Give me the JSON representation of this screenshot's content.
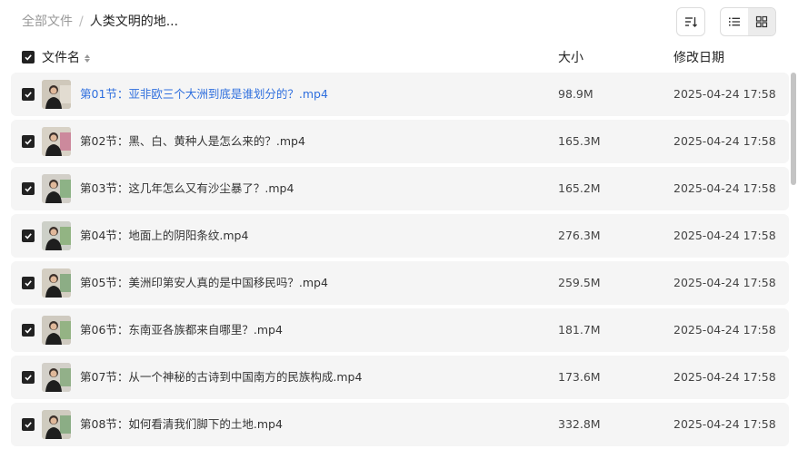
{
  "breadcrumb": {
    "root": "全部文件",
    "separator": "/",
    "current": "人类文明的地..."
  },
  "toolbar": {
    "sort_icon": "sort-lines-icon",
    "list_icon": "list-view-icon",
    "grid_icon": "grid-view-icon"
  },
  "columns": {
    "name": "文件名",
    "size": "大小",
    "date": "修改日期"
  },
  "files": [
    {
      "name": "第01节：亚非欧三个大洲到底是谁划分的？.mp4",
      "size": "98.9M",
      "date": "2025-04-24 17:58"
    },
    {
      "name": "第02节：黑、白、黄种人是怎么来的？.mp4",
      "size": "165.3M",
      "date": "2025-04-24 17:58"
    },
    {
      "name": "第03节：这几年怎么又有沙尘暴了？.mp4",
      "size": "165.2M",
      "date": "2025-04-24 17:58"
    },
    {
      "name": "第04节：地面上的阴阳条纹.mp4",
      "size": "276.3M",
      "date": "2025-04-24 17:58"
    },
    {
      "name": "第05节：美洲印第安人真的是中国移民吗？.mp4",
      "size": "259.5M",
      "date": "2025-04-24 17:58"
    },
    {
      "name": "第06节：东南亚各族都来自哪里？.mp4",
      "size": "181.7M",
      "date": "2025-04-24 17:58"
    },
    {
      "name": "第07节：从一个神秘的古诗到中国南方的民族构成.mp4",
      "size": "173.6M",
      "date": "2025-04-24 17:58"
    },
    {
      "name": "第08节：如何看清我们脚下的土地.mp4",
      "size": "332.8M",
      "date": "2025-04-24 17:58"
    }
  ]
}
